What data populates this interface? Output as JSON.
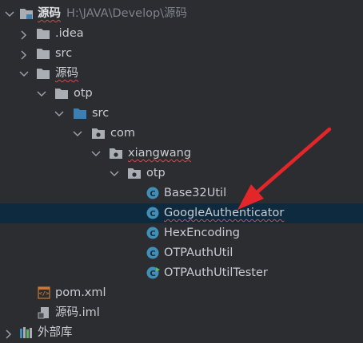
{
  "tree": {
    "root": {
      "label": "源码",
      "path": "H:\\JAVA\\Develop\\源码"
    },
    "idea": {
      "label": ".idea"
    },
    "src_top": {
      "label": "src"
    },
    "module": {
      "label": "源码"
    },
    "otp_dir": {
      "label": "otp"
    },
    "src_inner": {
      "label": "src"
    },
    "pkg_com": {
      "label": "com"
    },
    "pkg_xiangwang": {
      "label": "xiangwang"
    },
    "pkg_otp": {
      "label": "otp"
    },
    "files": [
      {
        "label": "Base32Util"
      },
      {
        "label": "GoogleAuthenticator"
      },
      {
        "label": "HexEncoding"
      },
      {
        "label": "OTPAuthUtil"
      },
      {
        "label": "OTPAuthUtilTester"
      }
    ],
    "pom": {
      "label": "pom.xml"
    },
    "iml": {
      "label": "源码.iml"
    },
    "external": {
      "label": "外部库"
    }
  },
  "colors": {
    "background": "#2b2d30",
    "selection": "#0e2a3f",
    "folder": "#a9adb4",
    "class_icon": "#3f8fb8",
    "annotation_arrow": "#e4262a"
  },
  "icons": {
    "folder": "folder-icon",
    "package": "package-icon",
    "class": "class-icon",
    "runnable_class": "runnable-class-icon",
    "maven": "maven-icon",
    "module_file": "module-file-icon",
    "library": "library-icon"
  }
}
